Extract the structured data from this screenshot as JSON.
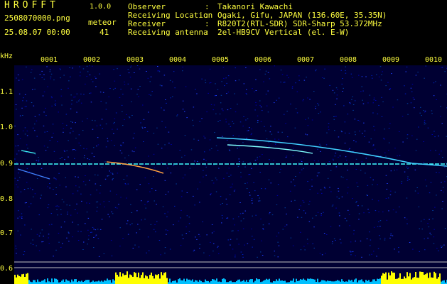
{
  "header": {
    "app_name": "HROFFT",
    "version": "1.0.0",
    "filename": "2508070000.png",
    "datetime": "25.08.07 00:00",
    "meteor_label": "meteor",
    "meteor_count": "41"
  },
  "info": [
    {
      "label": "Observer",
      "value": "Takanori Kawachi"
    },
    {
      "label": "Receiving Location",
      "value": "Ogaki, Gifu, JAPAN (136.60E, 35.35N)"
    },
    {
      "label": "Receiver",
      "value": "R820T2(RTL-SDR) SDR-Sharp 53.372MHz"
    },
    {
      "label": "Receiving antenna",
      "value": "2el-HB9CV Vertical (el. E-W)"
    }
  ],
  "info_separator": ":",
  "chart_data": {
    "type": "heatmap",
    "ylabel": "kHz",
    "y_ticks": [
      "1.1",
      "1.0",
      "0.9",
      "0.8",
      "0.7",
      "0.6"
    ],
    "x_ticks": [
      "0001",
      "0002",
      "0003",
      "0004",
      "0005",
      "0006",
      "0007",
      "0008",
      "0009",
      "0010"
    ],
    "carrier_khz": 0.9,
    "colors": {
      "background": "#000033",
      "text": "#ffff40",
      "carrier": "#40ffff",
      "level": "#ffff00",
      "level_base": "#00c0ff"
    }
  }
}
